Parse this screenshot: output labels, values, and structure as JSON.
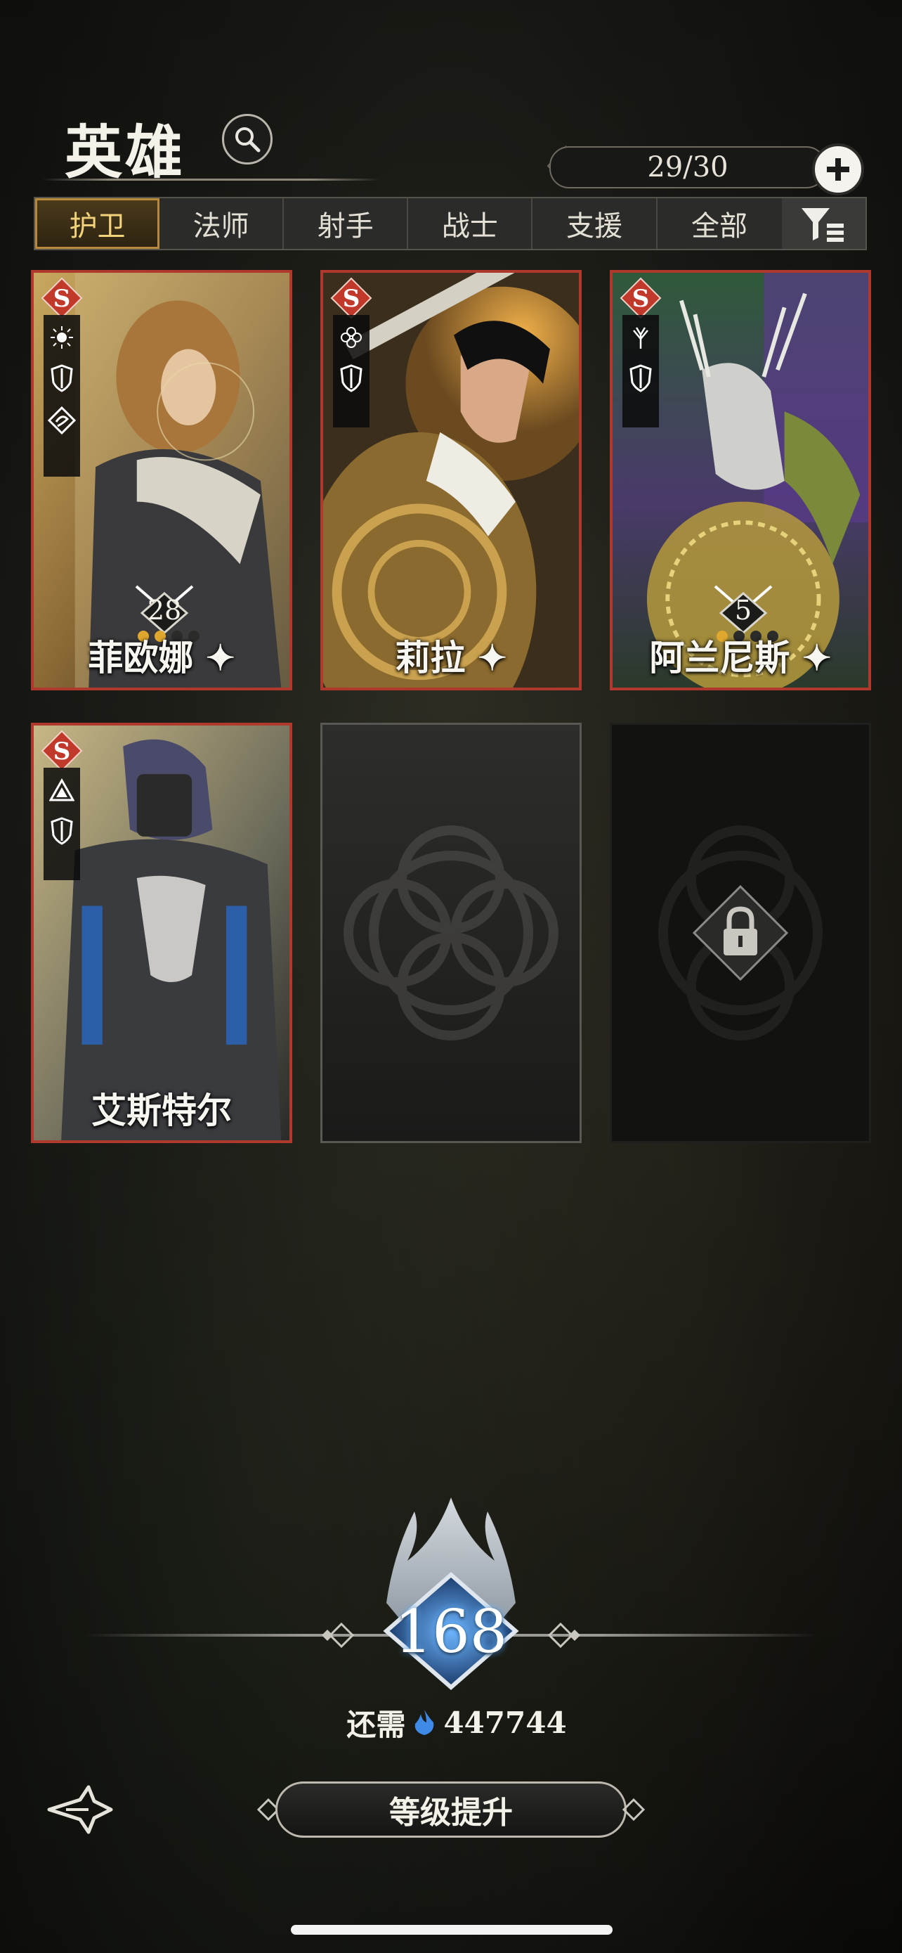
{
  "header": {
    "title": "英雄",
    "search_icon": "search-icon",
    "counter": "29/30",
    "add_icon": "plus-icon"
  },
  "tabs": [
    {
      "label": "护卫",
      "active": true
    },
    {
      "label": "法师",
      "active": false
    },
    {
      "label": "射手",
      "active": false
    },
    {
      "label": "战士",
      "active": false
    },
    {
      "label": "支援",
      "active": false
    },
    {
      "label": "全部",
      "active": false
    }
  ],
  "filter_icon": "filter-icon",
  "heroes": [
    {
      "name": "菲欧娜",
      "level": "28",
      "rank": "S",
      "star": true
    },
    {
      "name": "莉拉",
      "level": "",
      "rank": "S",
      "star": true
    },
    {
      "name": "阿兰尼斯",
      "level": "5",
      "rank": "S",
      "star": true
    },
    {
      "name": "艾斯特尔",
      "level": "",
      "rank": "S",
      "star": false
    }
  ],
  "footer": {
    "level": "168",
    "cost_label": "还需",
    "cost_value": "447744",
    "upgrade_label": "等级提升"
  },
  "colors": {
    "card_border": "#b0392e",
    "tab_active": "#b8893b",
    "level_glow": "#5fb0ff"
  }
}
